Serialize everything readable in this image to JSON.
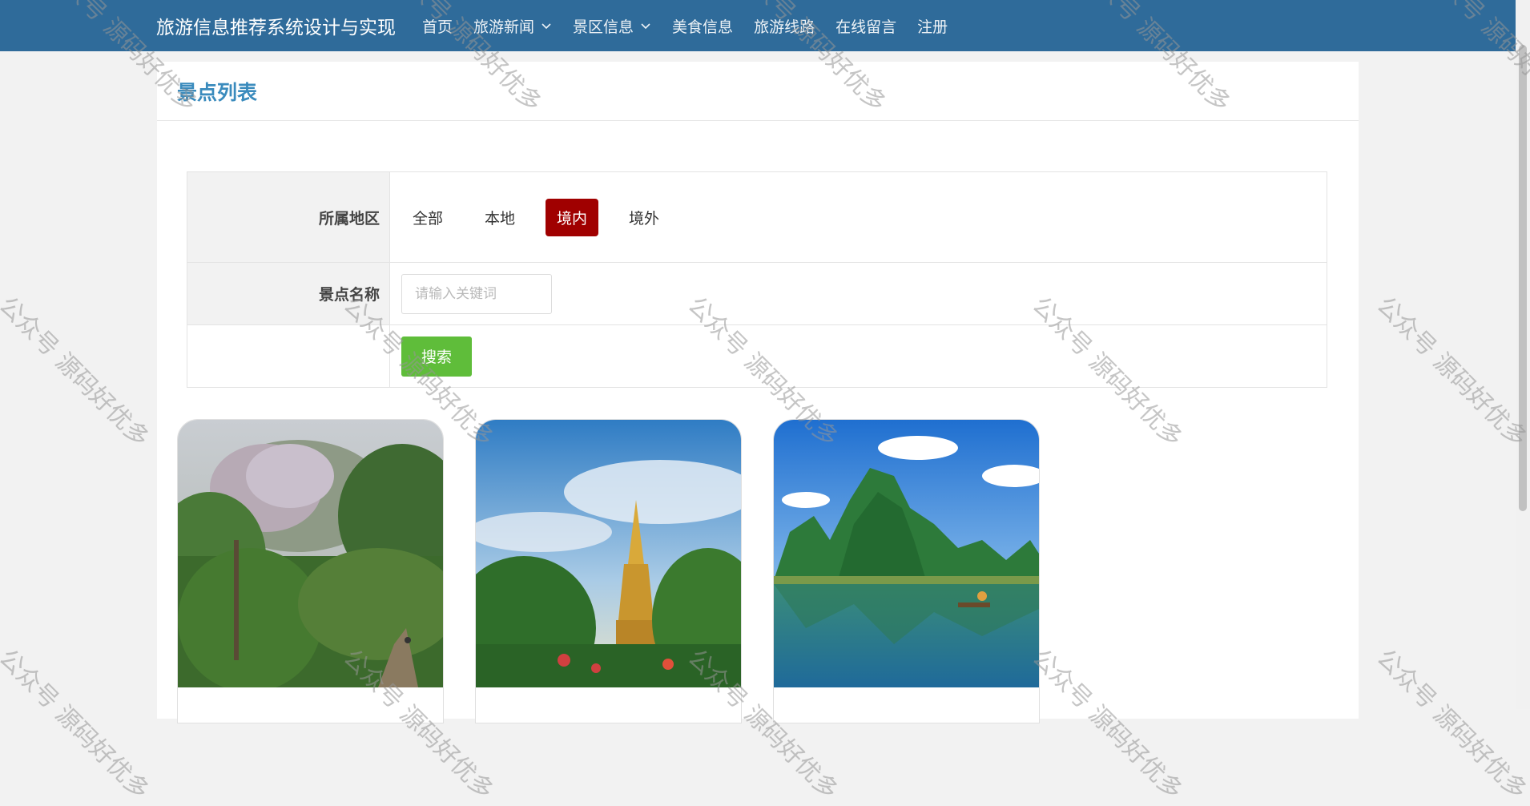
{
  "navbar": {
    "brand": "旅游信息推荐系统设计与实现",
    "items": [
      {
        "label": "首页"
      },
      {
        "label": "旅游新闻"
      },
      {
        "label": "景区信息"
      },
      {
        "label": "美食信息"
      },
      {
        "label": "旅游线路"
      },
      {
        "label": "在线留言"
      },
      {
        "label": "注册"
      }
    ]
  },
  "page": {
    "title": "景点列表"
  },
  "filter": {
    "region_label": "所属地区",
    "region_options": [
      "全部",
      "本地",
      "境内",
      "境外"
    ],
    "region_selected": "境内",
    "name_label": "景点名称",
    "keyword_value": "",
    "keyword_placeholder": "请输入关键词",
    "search_label": "搜索"
  },
  "watermark": "公众号 源码好优多",
  "colors": {
    "navbar": "#2f6b9a",
    "title": "#3a8bbd",
    "active_option": "#a00000",
    "search_button": "#5fbd3a"
  }
}
